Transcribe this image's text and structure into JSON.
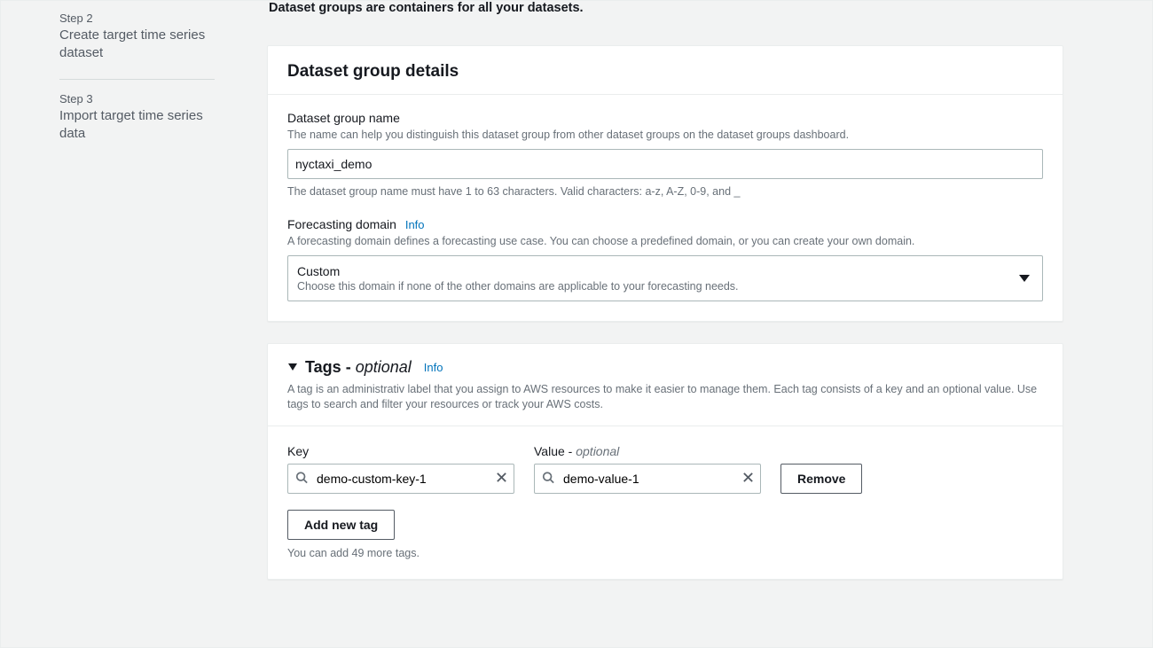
{
  "sidebar": {
    "steps": [
      {
        "label": "Step 2",
        "title": "Create target time series dataset"
      },
      {
        "label": "Step 3",
        "title": "Import target time series data"
      }
    ]
  },
  "intro": "Dataset groups are containers for all your datasets.",
  "info_label": "Info",
  "details": {
    "panel_title": "Dataset group details",
    "name": {
      "label": "Dataset group name",
      "desc": "The name can help you distinguish this dataset group from other dataset groups on the dataset groups dashboard.",
      "value": "nyctaxi_demo",
      "help": "The dataset group name must have 1 to 63 characters. Valid characters: a-z, A-Z, 0-9, and _"
    },
    "domain": {
      "label": "Forecasting domain",
      "desc": "A forecasting domain defines a forecasting use case. You can choose a predefined domain, or you can create your own domain.",
      "selected": "Custom",
      "selected_desc": "Choose this domain if none of the other domains are applicable to your forecasting needs."
    }
  },
  "tags": {
    "heading_main": "Tags",
    "heading_dash": " - ",
    "heading_optional": "optional",
    "desc": "A tag is an administrativ label that you assign to AWS resources to make it easier to manage them. Each tag consists of a key and an optional value. Use tags to search and filter your resources or track your AWS costs.",
    "key_label": "Key",
    "value_label_main": "Value",
    "value_label_dash": " - ",
    "value_label_optional": "optional",
    "rows": [
      {
        "key": "demo-custom-key-1",
        "value": "demo-value-1"
      }
    ],
    "remove_label": "Remove",
    "add_label": "Add new tag",
    "more": "You can add 49 more tags."
  }
}
